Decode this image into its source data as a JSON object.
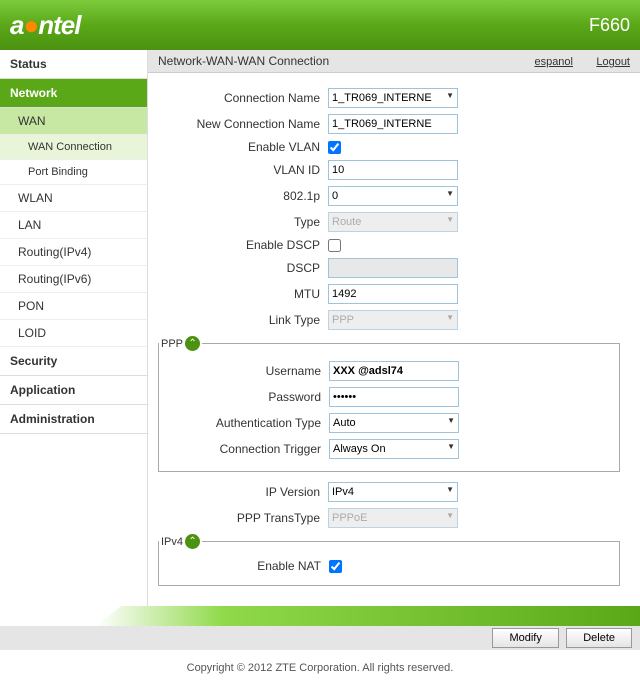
{
  "header": {
    "brand_a": "a",
    "brand_n": "ntel",
    "model": "F660"
  },
  "topbar": {
    "breadcrumb": "Network-WAN-WAN Connection",
    "lang": "espanol",
    "logout": "Logout"
  },
  "nav": {
    "status": "Status",
    "network": "Network",
    "wan": "WAN",
    "wan_connection": "WAN Connection",
    "port_binding": "Port Binding",
    "wlan": "WLAN",
    "lan": "LAN",
    "routing4": "Routing(IPv4)",
    "routing6": "Routing(IPv6)",
    "pon": "PON",
    "loid": "LOID",
    "security": "Security",
    "application": "Application",
    "administration": "Administration"
  },
  "labels": {
    "connection_name": "Connection Name",
    "new_connection_name": "New Connection Name",
    "enable_vlan": "Enable VLAN",
    "vlan_id": "VLAN ID",
    "p8021": "802.1p",
    "type": "Type",
    "enable_dscp": "Enable DSCP",
    "dscp": "DSCP",
    "mtu": "MTU",
    "link_type": "Link Type",
    "ppp_legend": "PPP",
    "username": "Username",
    "password": "Password",
    "auth_type": "Authentication Type",
    "conn_trigger": "Connection Trigger",
    "ip_version": "IP Version",
    "ppp_transtype": "PPP TransType",
    "ipv4_legend": "IPv4",
    "enable_nat": "Enable NAT"
  },
  "values": {
    "connection_name": "1_TR069_INTERNE",
    "new_connection_name": "1_TR069_INTERNE",
    "vlan_id": "10",
    "p8021": "0",
    "type": "Route",
    "dscp": "",
    "mtu": "1492",
    "link_type": "PPP",
    "username": "XXX @adsl74",
    "password": "••••••",
    "auth_type": "Auto",
    "conn_trigger": "Always On",
    "ip_version": "IPv4",
    "ppp_transtype": "PPPoE"
  },
  "buttons": {
    "modify": "Modify",
    "delete": "Delete"
  },
  "footer": {
    "copyright": "Copyright © 2012 ZTE Corporation. All rights reserved."
  }
}
